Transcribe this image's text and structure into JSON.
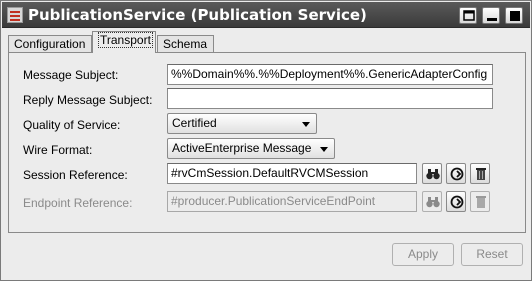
{
  "window": {
    "title": "PublicationService (Publication Service)",
    "title_bar_color": "#3f3f3f",
    "controls": [
      {
        "name": "maximize-restore",
        "icon": "window-restore-icon"
      },
      {
        "name": "minimize",
        "icon": "minimize-icon"
      },
      {
        "name": "close",
        "icon": "close-icon"
      }
    ]
  },
  "tabs": [
    {
      "label": "Configuration",
      "active": false
    },
    {
      "label": "Transport",
      "active": true
    },
    {
      "label": "Schema",
      "active": false
    }
  ],
  "form": {
    "message_subject": {
      "label": "Message Subject:",
      "value": "%%Domain%%.%%Deployment%%.GenericAdapterConfig"
    },
    "reply_message_subject": {
      "label": "Reply Message Subject:",
      "value": ""
    },
    "quality_of_service": {
      "label": "Quality of Service:",
      "selected": "Certified"
    },
    "wire_format": {
      "label": "Wire Format:",
      "selected": "ActiveEnterprise Message"
    },
    "session_reference": {
      "label": "Session Reference:",
      "value": "#rvCmSession.DefaultRVCMSession",
      "buttons": [
        "binoculars-icon",
        "goto-reference-icon",
        "trash-icon"
      ]
    },
    "endpoint_reference": {
      "label": "Endpoint Reference:",
      "value": "#producer.PublicationServiceEndPoint",
      "disabled": true,
      "buttons": [
        "binoculars-icon",
        "goto-reference-icon",
        "trash-icon"
      ]
    }
  },
  "actions": {
    "apply_label": "Apply",
    "reset_label": "Reset",
    "enabled": false
  }
}
